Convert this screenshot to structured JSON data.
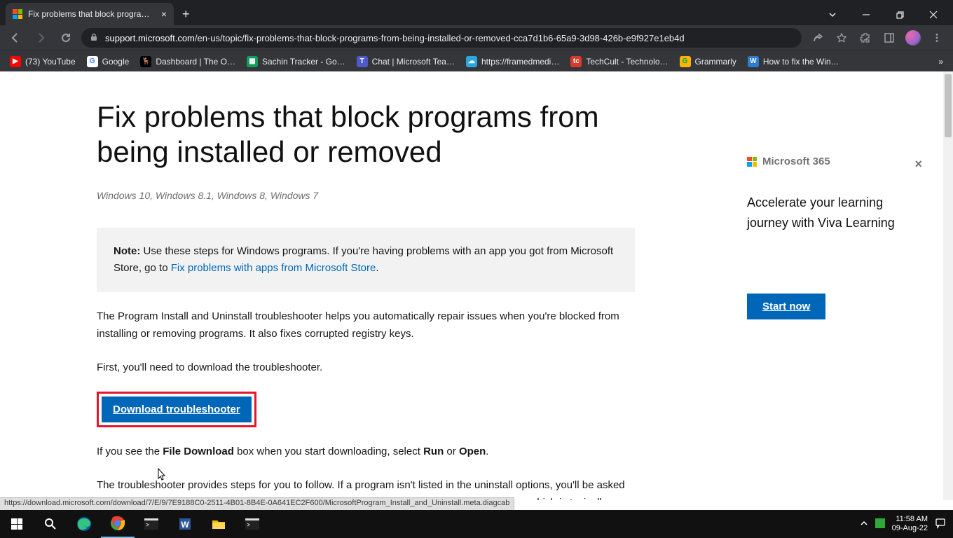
{
  "browser": {
    "tab_title": "Fix problems that block programs…",
    "url_domain": "support.microsoft.com",
    "url_path": "/en-us/topic/fix-problems-that-block-programs-from-being-installed-or-removed-cca7d1b6-65a9-3d98-426b-e9f927e1eb4d"
  },
  "bookmarks": [
    {
      "label": "(73) YouTube",
      "bg": "#ff0000",
      "glyph": "▶"
    },
    {
      "label": "Google",
      "bg": "#ffffff",
      "glyph": "G"
    },
    {
      "label": "Dashboard | The O…",
      "bg": "#cc8a2b",
      "glyph": "🦌"
    },
    {
      "label": "Sachin Tracker - Go…",
      "bg": "#0f9d58",
      "glyph": "▦"
    },
    {
      "label": "Chat | Microsoft Tea…",
      "bg": "#5059c9",
      "glyph": "👥"
    },
    {
      "label": "https://framedmedi…",
      "bg": "#2aa7de",
      "glyph": "☁"
    },
    {
      "label": "TechCult - Technolo…",
      "bg": "#d93a2b",
      "glyph": "tc"
    },
    {
      "label": "Grammarly",
      "bg": "#ffb400",
      "glyph": "G"
    },
    {
      "label": "How to fix the Win…",
      "bg": "#2b7cd3",
      "glyph": "W"
    }
  ],
  "page": {
    "title": "Fix problems that block programs from being installed or removed",
    "applies_to": "Windows 10, Windows 8.1, Windows 8, Windows 7",
    "note_label": "Note:",
    "note_text_before": " Use these steps for Windows programs. If you're having problems with an app you got from Microsoft Store, go to ",
    "note_link": "Fix problems with apps from Microsoft Store",
    "para1": "The Program Install and Uninstall troubleshooter helps you automatically repair issues when you're blocked from installing or removing programs. It also fixes corrupted registry keys.",
    "para2": "First, you'll need to download the troubleshooter.",
    "download_btn": "Download troubleshooter",
    "para3_before": "If you see the ",
    "para3_bold1": "File Download",
    "para3_mid": " box when you start downloading, select ",
    "para3_bold2": "Run",
    "para3_or": " or ",
    "para3_bold3": "Open",
    "para4": "The troubleshooter provides steps for you to follow. If a program isn't listed in the uninstall options, you'll be asked for that program's product code. To access the code, you'll need a tool for reading MSI files—which is typically available to IT professionals. You'll find the product code in the property table of the MSI file."
  },
  "promo": {
    "brand": "Microsoft 365",
    "text": "Accelerate your learning journey with Viva Learning",
    "cta": "Start now"
  },
  "status_url": "https://download.microsoft.com/download/7/E/9/7E9188C0-2511-4B01-8B4E-0A641EC2F600/MicrosoftProgram_Install_and_Uninstall.meta.diagcab",
  "tray": {
    "time": "11:58 AM",
    "date": "09-Aug-22"
  }
}
